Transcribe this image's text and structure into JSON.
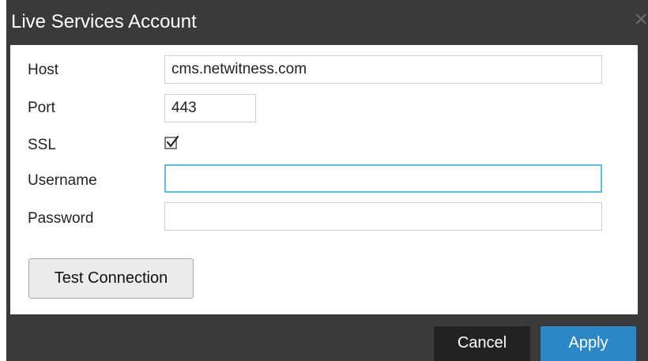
{
  "dialog": {
    "title": "Live Services Account",
    "close_icon": "close-icon"
  },
  "form": {
    "host": {
      "label": "Host",
      "value": "cms.netwitness.com"
    },
    "port": {
      "label": "Port",
      "value": "443"
    },
    "ssl": {
      "label": "SSL",
      "checked": true
    },
    "username": {
      "label": "Username",
      "value": ""
    },
    "password": {
      "label": "Password",
      "value": ""
    }
  },
  "actions": {
    "test_connection": "Test Connection",
    "cancel": "Cancel",
    "apply": "Apply"
  },
  "colors": {
    "chrome": "#3a3a3a",
    "apply": "#2b87c6",
    "cancel": "#222222",
    "focus": "#5bc0de"
  }
}
